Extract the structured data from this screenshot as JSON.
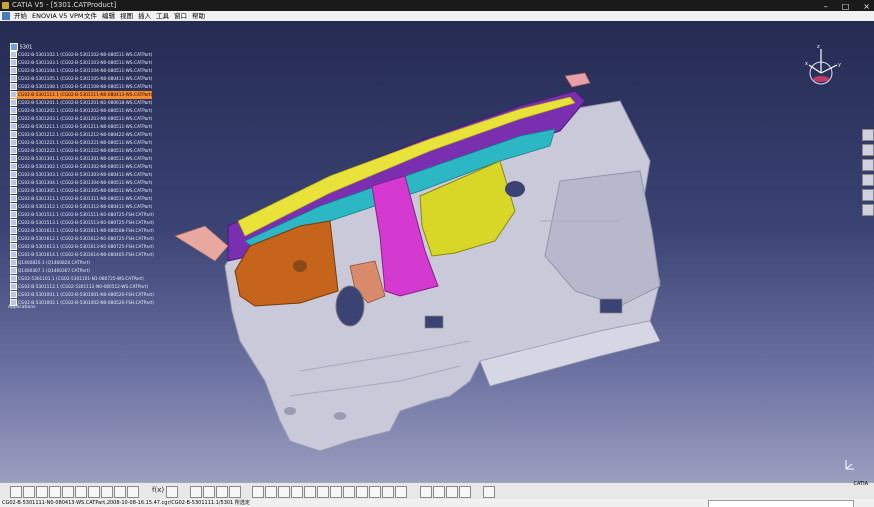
{
  "window": {
    "title": "CATIA V5 - [5301.CATProduct]",
    "controls": [
      "–",
      "□",
      "×"
    ]
  },
  "menu": {
    "items": [
      "开始",
      "ENOVIA V5 VPM",
      "文件",
      "编辑",
      "视图",
      "插入",
      "工具",
      "窗口",
      "帮助"
    ]
  },
  "tree": {
    "root": "5301",
    "items": [
      "CG02-B-5301102.1 (CG02-B-5301102-N0-080511-WS.CATPart)",
      "CG02-B-5301103.1 (CG02-B-5301103-N0-080511-WS.CATPart)",
      "CG02-B-5301104.1 (CG02-B-5301104-N0-080511-WS.CATPart)",
      "CG02-B-5301105.1 (CG02-B-5301105-N0-080411-WS.CATPart)",
      "CG02-B-5301108.1 (CG02-B-5301108-N0-080511-WS.CATPart)",
      "CG02-B-5301111.1 (CG02-B-5301111-N0-080413-WS.CATPart)",
      "CG02-B-5301201.1 (CG02-B-5301201-N1-080618-WS.CATPart)",
      "CG02-B-5301202.1 (CG02-B-5301202-N0-080511-WS.CATPart)",
      "CG02-B-5301203.1 (CG02-B-5301203-N0-080511-WS.CATPart)",
      "CG02-B-5301211.1 (CG02-B-5301211-N0-080511-WS.CATPart)",
      "CG02-B-5301212.1 (CG02-B-5301212-N0-080422-WS.CATPart)",
      "CG02-B-5301221.1 (CG02-B-5301221-N0-080511-WS.CATPart)",
      "CG02-B-5301222.1 (CG02-B-5301222-N0-080511-WS.CATPart)",
      "CG02-B-5301301.1 (CG02-B-5301301-N0-080511-WS.CATPart)",
      "CG02-B-5301302.1 (CG02-B-5301302-N0-080511-WS.CATPart)",
      "CG02-B-5301303.1 (CG02-B-5301303-N0-080411-WS.CATPart)",
      "CG02-B-5301304.1 (CG02-B-5301304-N0-080511-WS.CATPart)",
      "CG02-B-5301305.1 (CG02-B-5301305-N0-080511-WS.CATPart)",
      "CG02-B-5301311.1 (CG02-B-5301311-N0-080511-WS.CATPart)",
      "CG02-B-5301312.1 (CG02-B-5301312-N0-080411-WS.CATPart)",
      "CG02-B-5301511.1 (CG02-B-5301511-N1-080725-FSH.CATPart)",
      "CG02-B-5301513.1 (CG02-B-5301513-N1-080725-FSH.CATPart)",
      "CG02-B-5301611.1 (CG02-B-5301611-N0-080508-FSH.CATPart)",
      "CG02-B-5301612.1 (CG02-B-5301612-N1-080725-FSH.CATPart)",
      "CG02-B-5301613.1 (CG02-B-5301613-N1-080725-FSH.CATPart)",
      "CG02-B-5301614.1 (CG02-B-5301614-N0-080405-FSH.CATPart)",
      "Q1400820.1 (Q1400820.CATPart)",
      "Q1400307.1 (Q1400307.CATPart)",
      "CG02-5301101.1 (CG02-5301101-N1-080725-WS.CATPart)",
      "CG02-B-5301112.1 (CG02-5301112-N0-080512-WS.CATPart)",
      "CG02-B-5301001.1 (CG02-B-5301001-N0-080520-FSH.CATPart)",
      "CG02-B-5301002.1 (CG02-B-5301002-N0-080520-FSH.CATPart)"
    ],
    "selected_index": 5,
    "tail": "Applications"
  },
  "toolbar": {
    "label": "f(x)"
  },
  "status": {
    "text": "CG02-B-5301111-N0-080413-WS.CATPart,2008-10-08-16.15.47.cgr/CG02-B-5301111.1/5301 所选定"
  },
  "brand": {
    "logo_text": "CATIA"
  },
  "colors": {
    "background_top": "#252b52",
    "background_bottom": "#9b9ec0",
    "selection": "#ff8a2a"
  }
}
